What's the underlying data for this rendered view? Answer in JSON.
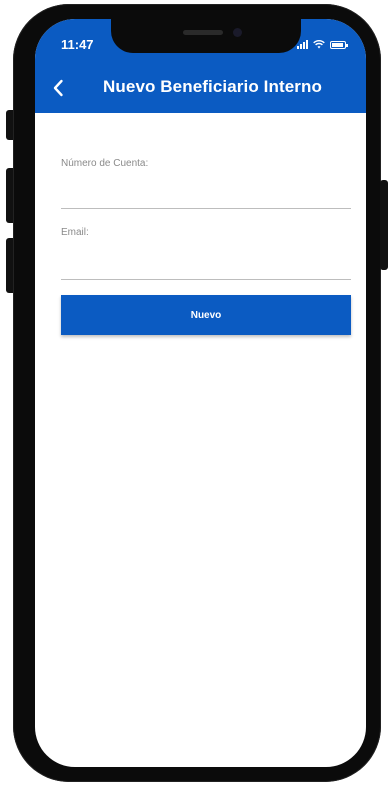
{
  "status_bar": {
    "time": "11:47",
    "icons": [
      "signal-icon",
      "wifi-icon",
      "battery-icon"
    ]
  },
  "nav": {
    "back_icon": "chevron-left-icon",
    "title": "Nuevo Beneficiario Interno"
  },
  "form": {
    "account_label": "Número de Cuenta:",
    "account_value": "",
    "email_label": "Email:",
    "email_value": "",
    "submit_label": "Nuevo"
  },
  "colors": {
    "primary": "#0b5bc2",
    "background": "#ffffff",
    "label": "#8a8a8a",
    "divider": "#bdbdbd"
  }
}
